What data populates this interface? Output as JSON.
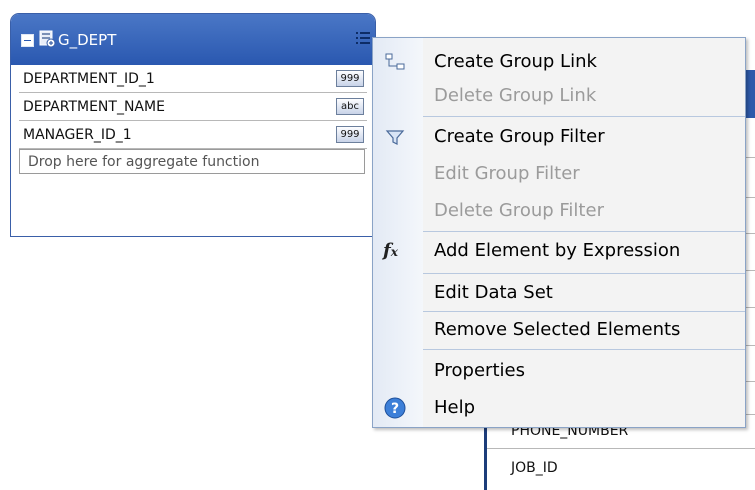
{
  "group": {
    "title": "G_DEPT",
    "fields": [
      {
        "name": "DEPARTMENT_ID_1",
        "type": "999"
      },
      {
        "name": "DEPARTMENT_NAME",
        "type": "abc"
      },
      {
        "name": "MANAGER_ID_1",
        "type": "999"
      }
    ],
    "drop_hint": "Drop here for aggregate function"
  },
  "background_table": {
    "rows": [
      "PHONE_NUMBER",
      "JOB_ID"
    ]
  },
  "context_menu": {
    "items": [
      {
        "label": "Create Group Link",
        "icon": "group-link-icon",
        "enabled": true
      },
      {
        "label": "Delete Group Link",
        "enabled": false
      },
      {
        "label": "Create Group Filter",
        "icon": "filter-icon",
        "enabled": true
      },
      {
        "label": "Edit Group Filter",
        "enabled": false
      },
      {
        "label": "Delete Group Filter",
        "enabled": false
      },
      {
        "label": "Add Element by Expression",
        "icon": "fx-icon",
        "enabled": true
      },
      {
        "label": "Edit Data Set",
        "enabled": true
      },
      {
        "label": "Remove Selected Elements",
        "enabled": true
      },
      {
        "label": "Properties",
        "enabled": true
      },
      {
        "label": "Help",
        "icon": "help-icon",
        "enabled": true
      }
    ]
  },
  "colors": {
    "header_blue": "#2a58b0",
    "menu_border": "#8aa3c6",
    "disabled_text": "#9b9b9b"
  }
}
